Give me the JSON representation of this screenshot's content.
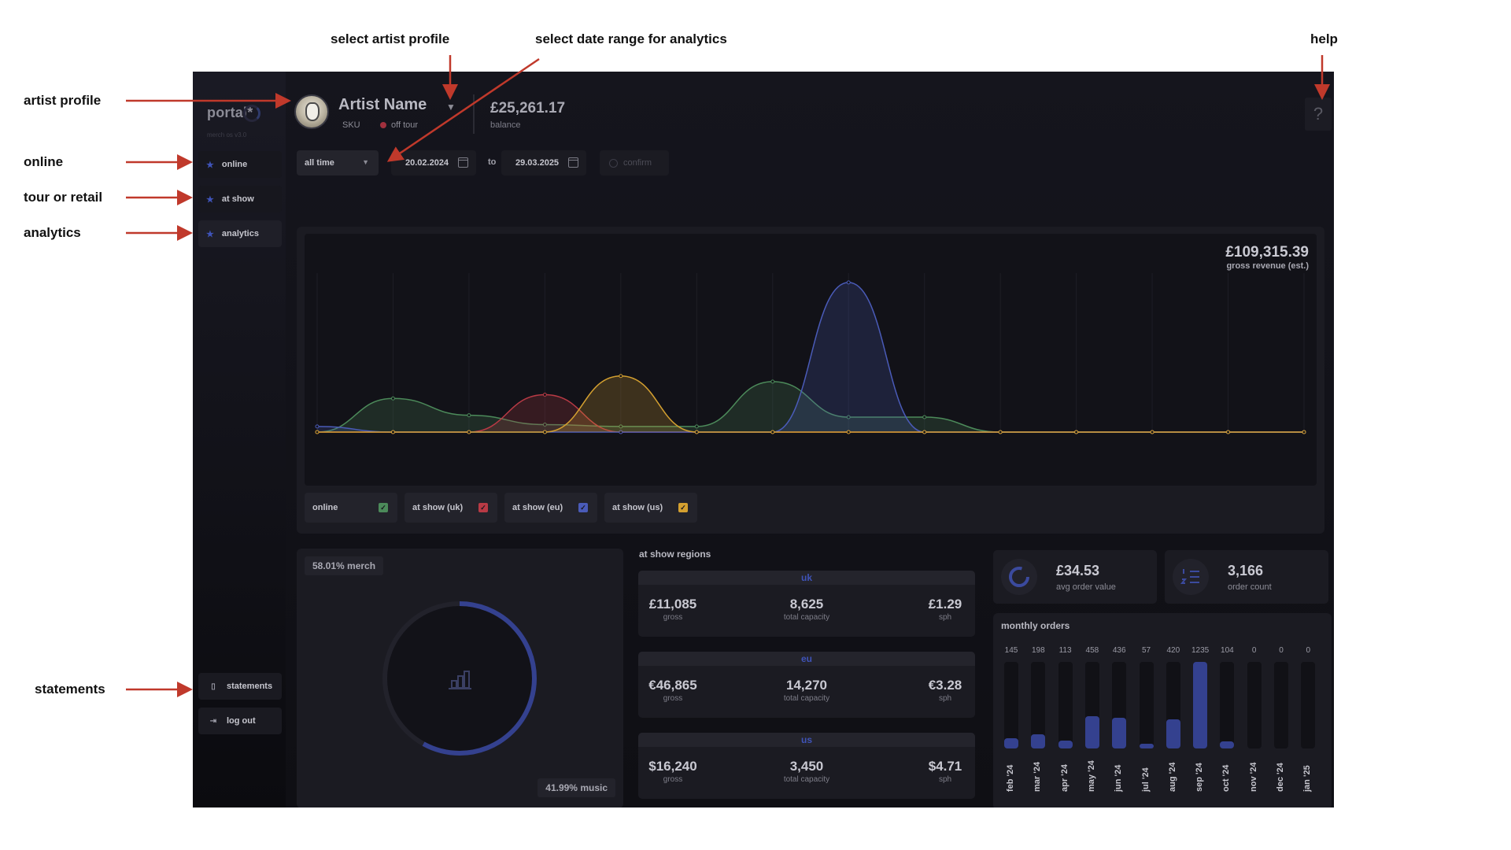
{
  "annotations": {
    "artist_profile": "artist profile",
    "online": "online",
    "tour_or_retail": "tour or retail",
    "analytics": "analytics",
    "statements": "statements",
    "select_artist_profile": "select artist profile",
    "select_date_range": "select date range for analytics",
    "help": "help"
  },
  "sidebar": {
    "logo": "portal*",
    "version": "merch os v3.0",
    "items": [
      {
        "label": "online"
      },
      {
        "label": "at show"
      },
      {
        "label": "analytics"
      }
    ],
    "statements_label": "statements",
    "logout_label": "log out"
  },
  "header": {
    "artist_name": "Artist Name",
    "sku": "SKU",
    "status": "off tour",
    "balance_value": "£25,261.17",
    "balance_label": "balance",
    "help_symbol": "?"
  },
  "filters": {
    "range": "all time",
    "from": "20.02.2024",
    "to_label": "to",
    "to": "29.03.2025",
    "confirm": "confirm"
  },
  "revenue": {
    "value": "£109,315.39",
    "label": "gross revenue (est.)"
  },
  "legend": [
    {
      "label": "online",
      "color": "#4c8a5a"
    },
    {
      "label": "at show (uk)",
      "color": "#b83a45"
    },
    {
      "label": "at show (eu)",
      "color": "#4a5bb8"
    },
    {
      "label": "at show (us)",
      "color": "#d4a030"
    }
  ],
  "chart_data": {
    "type": "area",
    "x_points": 14,
    "series": [
      {
        "name": "online",
        "color": "#4c8a5a",
        "values": [
          0,
          18,
          9,
          4,
          3,
          3,
          27,
          8,
          8,
          0,
          0,
          0,
          0,
          0
        ]
      },
      {
        "name": "at show (uk)",
        "color": "#b83a45",
        "values": [
          0,
          0,
          0,
          20,
          0,
          0,
          0,
          0,
          0,
          0,
          0,
          0,
          0,
          0
        ]
      },
      {
        "name": "at show (eu)",
        "color": "#4a5bb8",
        "values": [
          3,
          0,
          0,
          0,
          0,
          0,
          0,
          80,
          0,
          0,
          0,
          0,
          0,
          0
        ]
      },
      {
        "name": "at show (us)",
        "color": "#d4a030",
        "values": [
          0,
          0,
          0,
          0,
          30,
          0,
          0,
          0,
          0,
          0,
          0,
          0,
          0,
          0
        ]
      }
    ],
    "ylim": [
      0,
      85
    ],
    "grid": true
  },
  "split": {
    "merch_label": "58.01% merch",
    "music_label": "41.99% music",
    "merch_share": 0.5801,
    "music_share": 0.4199
  },
  "regions": {
    "title": "at show regions",
    "items": [
      {
        "name": "uk",
        "gross": "£11,085",
        "capacity": "8,625",
        "sph": "£1.29"
      },
      {
        "name": "eu",
        "gross": "€46,865",
        "capacity": "14,270",
        "sph": "€3.28"
      },
      {
        "name": "us",
        "gross": "$16,240",
        "capacity": "3,450",
        "sph": "$4.71"
      }
    ],
    "gross_label": "gross",
    "capacity_label": "total capacity",
    "sph_label": "sph"
  },
  "kpis": {
    "aov_value": "£34.53",
    "aov_label": "avg order value",
    "orders_value": "3,166",
    "orders_label": "order count"
  },
  "monthly_orders": {
    "title": "monthly orders",
    "months": [
      "feb '24",
      "mar '24",
      "apr '24",
      "may '24",
      "jun '24",
      "jul '24",
      "aug '24",
      "sep '24",
      "oct '24",
      "nov '24",
      "dec '24",
      "jan '25"
    ],
    "counts": [
      145,
      198,
      113,
      458,
      436,
      57,
      420,
      1235,
      104,
      0,
      0,
      0
    ],
    "count_labels": [
      "145",
      "198",
      "113",
      "458",
      "436",
      "57",
      "420",
      "1235",
      "104",
      "0",
      "0",
      "0"
    ]
  }
}
